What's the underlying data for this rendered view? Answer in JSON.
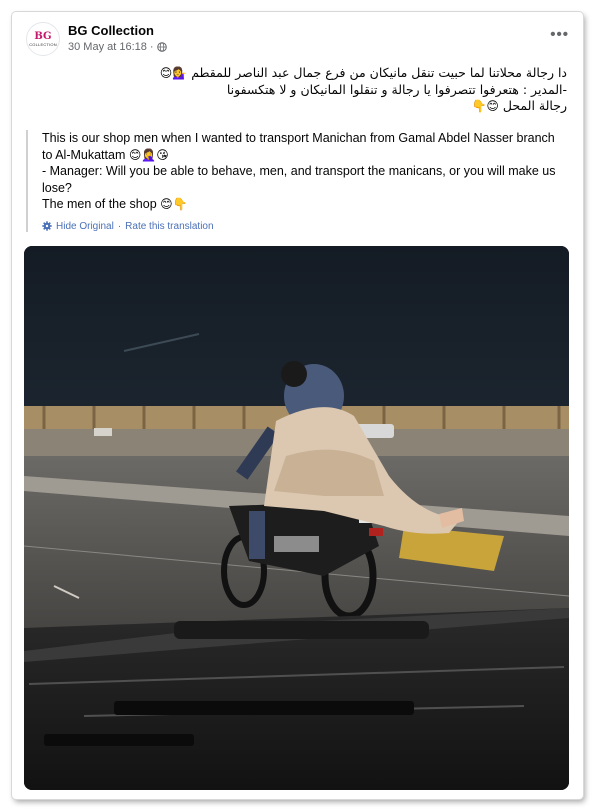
{
  "post": {
    "page_name": "BG Collection",
    "timestamp": "30 May at 16:18",
    "separator": "·",
    "more_label": "•••",
    "avatar": {
      "logo_text": "BG",
      "logo_subtext": "COLLECTION"
    },
    "original_text": [
      "دا رجالة محلاتنا لما حبيت تنقل مانيكان من فرع جمال عبد الناصر للمقطم",
      "-المدير : هتعرفوا تتصرفوا يا رجالة و تنقلوا المانيكان و لا هتكسفونا",
      "رجالة المحل"
    ],
    "original_emojis": [
      "💁‍♀️😊",
      "",
      "😊👇"
    ],
    "translation": {
      "lines": [
        "This is our shop men when I wanted to transport Manichan from Gamal Abdel Nasser branch to Al-Mukattam",
        "- Manager: Will you be able to behave, men, and transport the manicans, or you will make us lose?",
        "The men of the shop"
      ],
      "line_emojis": [
        "😊🤦‍♀️😘",
        "",
        "😊👇"
      ],
      "hide_original": "Hide Original",
      "rate": "Rate this translation",
      "link_separator": "·"
    },
    "photo": {
      "icon": "photo-image"
    }
  }
}
